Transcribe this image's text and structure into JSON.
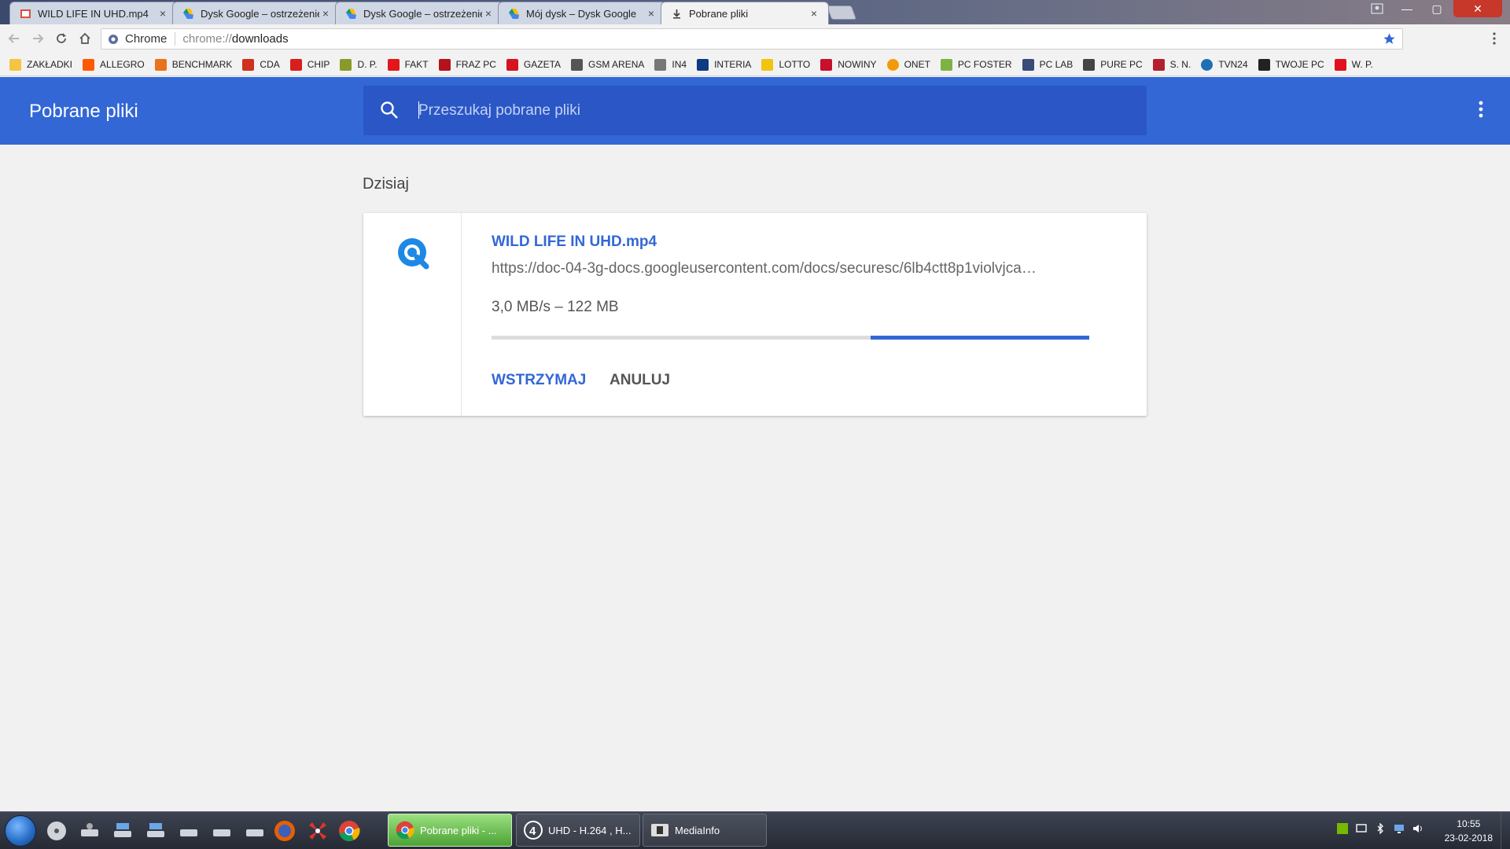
{
  "tabs": [
    {
      "label": "WILD LIFE IN UHD.mp4",
      "icon": "film-icon",
      "active": false
    },
    {
      "label": "Dysk Google – ostrzeżenie",
      "icon": "google-drive-icon",
      "active": false
    },
    {
      "label": "Dysk Google – ostrzeżenie",
      "icon": "google-drive-icon",
      "active": false
    },
    {
      "label": "Mój dysk – Dysk Google",
      "icon": "google-drive-icon",
      "active": false
    },
    {
      "label": "Pobrane pliki",
      "icon": "download-icon",
      "active": true
    }
  ],
  "tab_close_glyph": "×",
  "window_controls": {
    "minimize": "—",
    "maximize": "▢",
    "close": "✕"
  },
  "omnibox": {
    "chip_label": "Chrome",
    "url_scheme": "chrome://",
    "url_host": "downloads"
  },
  "bookmarks": [
    {
      "label": "ZAKŁADKI",
      "color": "#f5c542"
    },
    {
      "label": "ALLEGRO",
      "color": "#ff5a00"
    },
    {
      "label": "BENCHMARK",
      "color": "#e8731c"
    },
    {
      "label": "CDA",
      "color": "#d0301f"
    },
    {
      "label": "CHIP",
      "color": "#d91e1e"
    },
    {
      "label": "D. P.",
      "color": "#8a9a2a"
    },
    {
      "label": "FAKT",
      "color": "#e3171b"
    },
    {
      "label": "FRAZ PC",
      "color": "#b5121b"
    },
    {
      "label": "GAZETA",
      "color": "#d6131e"
    },
    {
      "label": "GSM ARENA",
      "color": "#555555"
    },
    {
      "label": "IN4",
      "color": "#777777"
    },
    {
      "label": "INTERIA",
      "color": "#0d3a80"
    },
    {
      "label": "LOTTO",
      "color": "#f2c40f"
    },
    {
      "label": "NOWINY",
      "color": "#c8102e"
    },
    {
      "label": "ONET",
      "color": "#f39a0a"
    },
    {
      "label": "PC FOSTER",
      "color": "#7cb342"
    },
    {
      "label": "PC LAB",
      "color": "#3a4a7a"
    },
    {
      "label": "PURE PC",
      "color": "#444444"
    },
    {
      "label": "S. N.",
      "color": "#b3202d"
    },
    {
      "label": "TVN24",
      "color": "#1f6fb5"
    },
    {
      "label": "TWOJE PC",
      "color": "#222222"
    },
    {
      "label": "W. P.",
      "color": "#e2101d"
    }
  ],
  "downloads": {
    "title": "Pobrane pliki",
    "search_placeholder": "Przeszukaj pobrane pliki",
    "date_header": "Dzisiaj",
    "item": {
      "file_name": "WILD LIFE IN UHD.mp4",
      "url": "https://doc-04-3g-docs.googleusercontent.com/docs/securesc/6lb4ctt8p1violvjca…",
      "status": "3,0 MB/s – 122 MB",
      "progress_remaining_fraction": 0.366,
      "pause_label": "WSTRZYMAJ",
      "cancel_label": "ANULUJ"
    }
  },
  "taskbar": {
    "tasks": [
      {
        "label": "Pobrane pliki - ...",
        "icon": "chrome-icon",
        "active": true
      },
      {
        "label": "UHD - H.264 , H...",
        "icon": "number-four-icon",
        "active": false
      },
      {
        "label": "MediaInfo",
        "icon": "mediainfo-icon",
        "active": false
      }
    ],
    "clock_time": "10:55",
    "clock_date": "23-02-2018"
  },
  "colors": {
    "accent": "#3367d6",
    "header_dark": "#2a56c6",
    "page_bg": "#f1f1f1"
  }
}
